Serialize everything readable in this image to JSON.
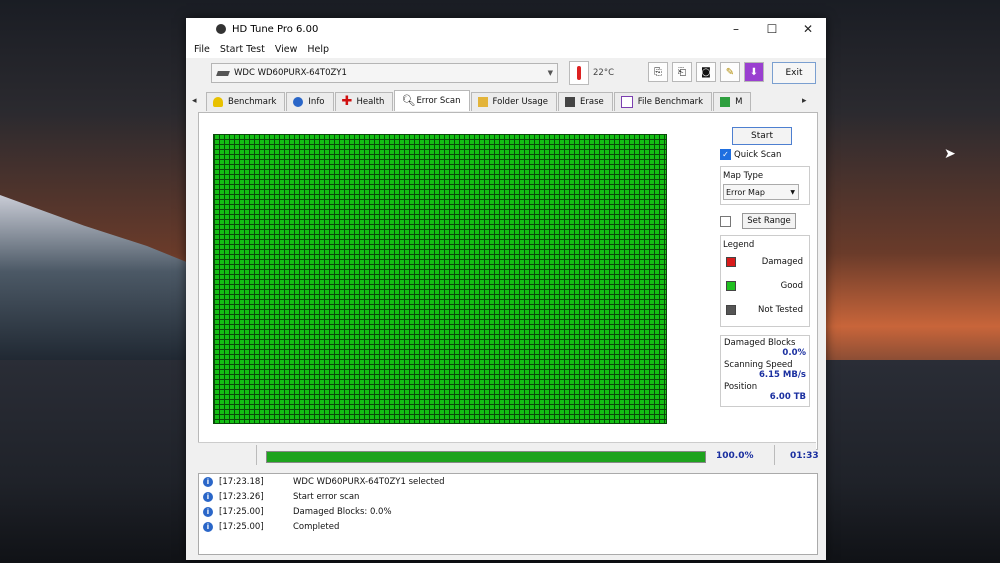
{
  "window": {
    "title": "HD Tune Pro 6.00",
    "controls": [
      "–",
      "☐",
      "✕"
    ]
  },
  "menu": [
    "File",
    "Start Test",
    "View",
    "Help"
  ],
  "toolbar": {
    "drive": "WDC WD60PURX-64T0ZY1",
    "temperature": "22°C",
    "exit_label": "Exit",
    "icons": [
      "copy-icon",
      "copy-all-icon",
      "camera-icon",
      "tools-icon",
      "download-icon"
    ]
  },
  "tabs": [
    {
      "label": "Benchmark",
      "icon": "thermometer-icon"
    },
    {
      "label": "Info",
      "icon": "info-icon"
    },
    {
      "label": "Health",
      "icon": "health-cross-icon"
    },
    {
      "label": "Error Scan",
      "icon": "magnifier-icon",
      "active": true
    },
    {
      "label": "Folder Usage",
      "icon": "folder-icon"
    },
    {
      "label": "Erase",
      "icon": "trash-icon"
    },
    {
      "label": "File Benchmark",
      "icon": "file-icon"
    },
    {
      "label": "M",
      "icon": "chart-icon"
    }
  ],
  "scan": {
    "start_label": "Start",
    "quick_scan_label": "Quick Scan",
    "quick_scan_checked": true,
    "map_type_label": "Map Type",
    "map_type_value": "Error Map",
    "set_range_label": "Set Range",
    "set_range_checked": false,
    "legend_title": "Legend",
    "legend": [
      {
        "label": "Damaged",
        "color": "#d81b1b"
      },
      {
        "label": "Good",
        "color": "#20c020"
      },
      {
        "label": "Not Tested",
        "color": "#555555"
      }
    ],
    "damaged_blocks_label": "Damaged Blocks",
    "damaged_blocks_value": "0.0%",
    "speed_label": "Scanning Speed",
    "speed_value": "6.15 MB/s",
    "position_label": "Position",
    "position_value": "6.00 TB",
    "map_color": "#14bf14"
  },
  "progress": {
    "fraction": 1.0,
    "percent_label": "100.0%",
    "time": "01:33"
  },
  "log": [
    {
      "time": "[17:23.18]",
      "message": "WDC WD60PURX-64T0ZY1 selected"
    },
    {
      "time": "[17:23.26]",
      "message": "Start error scan"
    },
    {
      "time": "[17:25.00]",
      "message": "Damaged Blocks: 0.0%"
    },
    {
      "time": "[17:25.00]",
      "message": "Completed"
    }
  ]
}
